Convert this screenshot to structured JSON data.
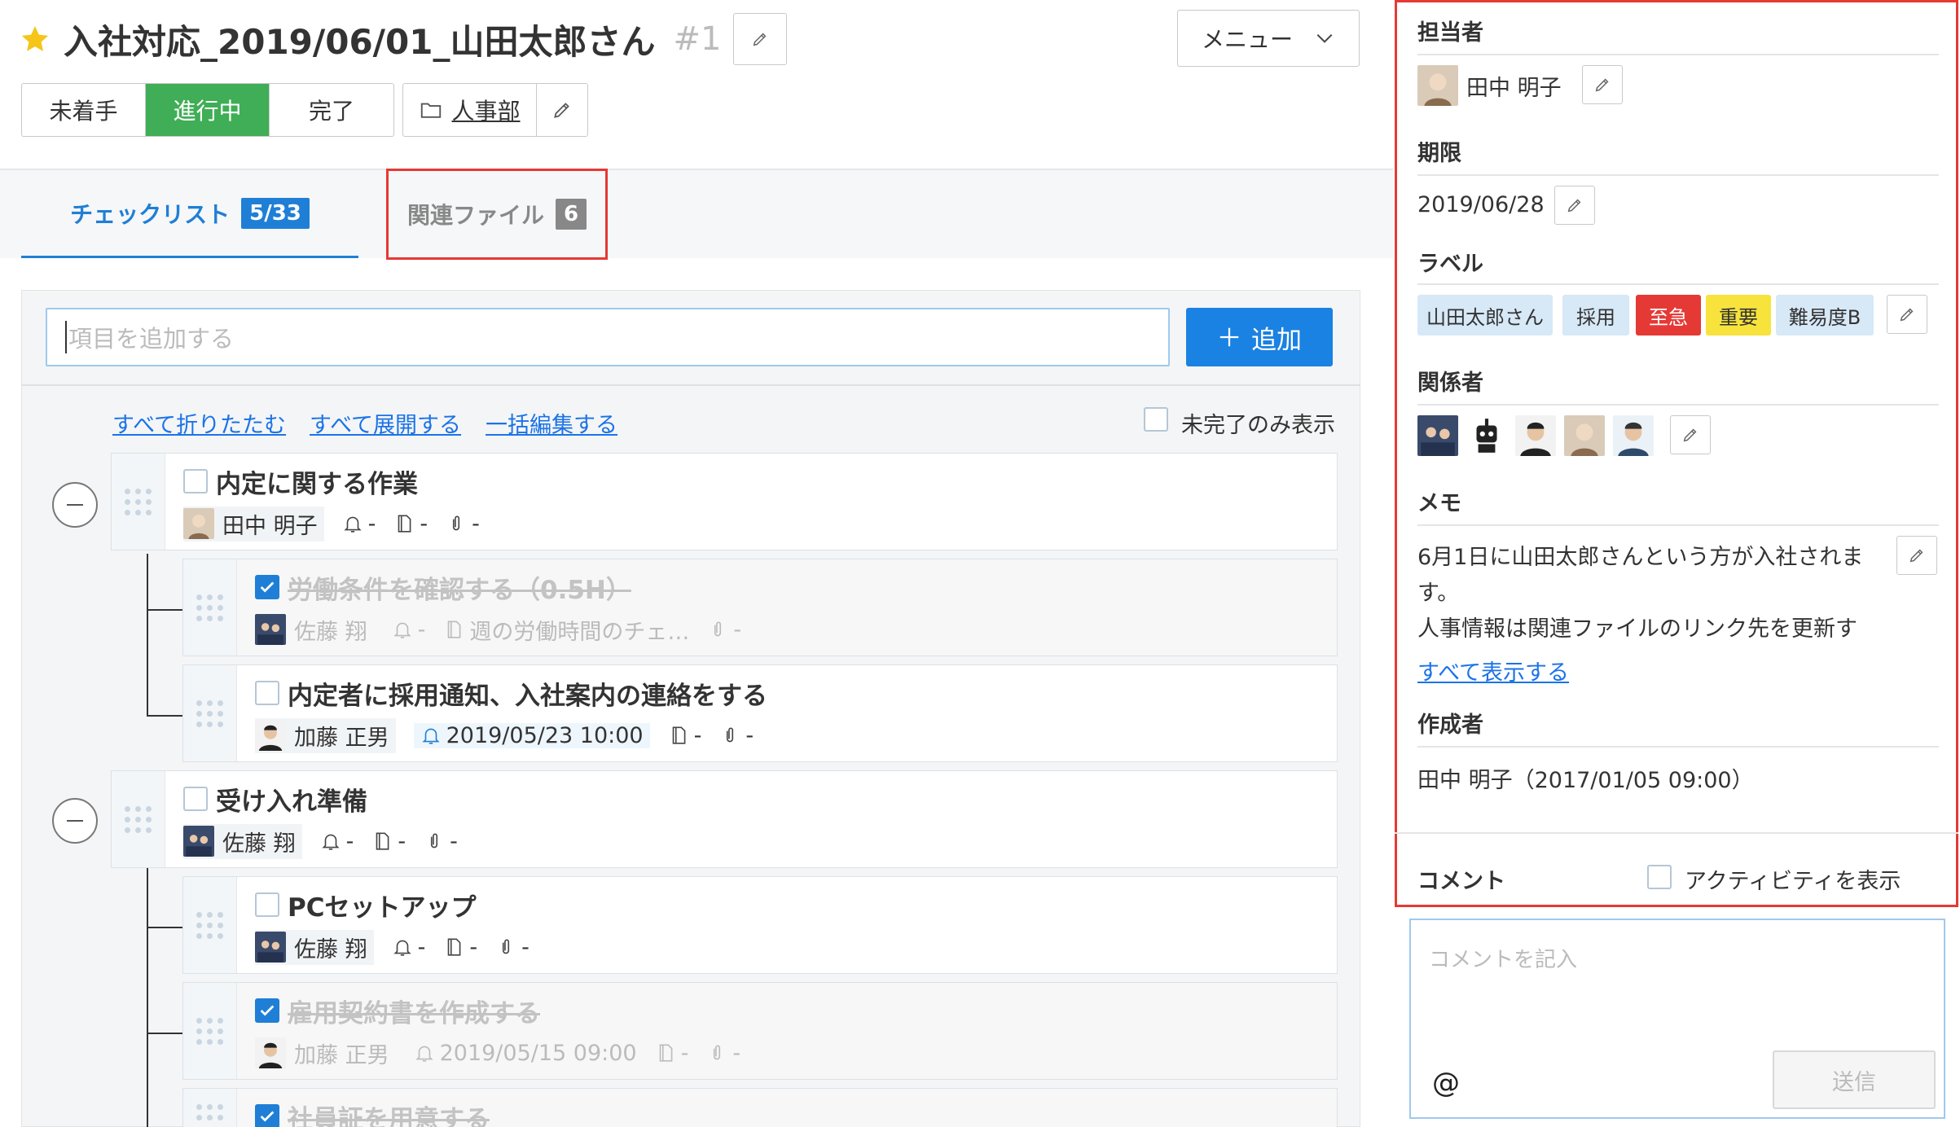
{
  "header": {
    "title": "入社対応_2019/06/01_山田太郎さん",
    "number": "#1",
    "menu_label": "メニュー"
  },
  "status": {
    "options": [
      "未着手",
      "進行中",
      "完了"
    ],
    "active": "進行中"
  },
  "department": {
    "label": "人事部"
  },
  "tabs": {
    "checklist": {
      "label": "チェックリスト",
      "badge": "5/33"
    },
    "files": {
      "label": "関連ファイル",
      "badge": "6"
    }
  },
  "checklist": {
    "add_placeholder": "項目を追加する",
    "add_button": "追加",
    "links": {
      "collapse_all": "すべて折りたたむ",
      "expand_all": "すべて展開する",
      "bulk_edit": "一括編集する"
    },
    "incomplete_only_label": "未完了のみ表示",
    "items": [
      {
        "title": "内定に関する作業",
        "assignee": "田中 明子",
        "reminder": "-",
        "note": "-",
        "attach": "-",
        "checked": false
      },
      {
        "title": "労働条件を確認する（0.5H）",
        "assignee": "佐藤 翔",
        "reminder": "-",
        "note": "週の労働時間のチェ…",
        "attach": "-",
        "checked": true
      },
      {
        "title": "内定者に採用通知、入社案内の連絡をする",
        "assignee": "加藤 正男",
        "reminder": "2019/05/23 10:00",
        "note": "-",
        "attach": "-",
        "checked": false
      },
      {
        "title": "受け入れ準備",
        "assignee": "佐藤 翔",
        "reminder": "-",
        "note": "-",
        "attach": "-",
        "checked": false
      },
      {
        "title": "PCセットアップ",
        "assignee": "佐藤 翔",
        "reminder": "-",
        "note": "-",
        "attach": "-",
        "checked": false
      },
      {
        "title": "雇用契約書を作成する",
        "assignee": "加藤 正男",
        "reminder": "2019/05/15 09:00",
        "note": "-",
        "attach": "-",
        "checked": true
      },
      {
        "title": "社員証を用意する",
        "checked": true
      }
    ]
  },
  "sidebar": {
    "assignee_heading": "担当者",
    "assignee_name": "田中 明子",
    "due_heading": "期限",
    "due_date": "2019/06/28",
    "label_heading": "ラベル",
    "labels": [
      {
        "text": "山田太郎さん",
        "bg": "#d7e8f7",
        "fg": "#333333"
      },
      {
        "text": "採用",
        "bg": "#d7e8f7",
        "fg": "#333333"
      },
      {
        "text": "至急",
        "bg": "#e53935",
        "fg": "#ffffff"
      },
      {
        "text": "重要",
        "bg": "#f7e33b",
        "fg": "#333333"
      },
      {
        "text": "難易度B",
        "bg": "#d7e8f7",
        "fg": "#333333"
      }
    ],
    "members_heading": "関係者",
    "memo_heading": "メモ",
    "memo_line1": "6月1日に山田太郎さんという方が入社されま",
    "memo_line2": "す。",
    "memo_line3": "人事情報は関連ファイルのリンク先を更新す",
    "memo_show_all": "すべて表示する",
    "creator_heading": "作成者",
    "creator_text": "田中 明子（2017/01/05 09:00）",
    "comment_heading": "コメント",
    "activity_label": "アクティビティを表示",
    "comment_placeholder": "コメントを記入",
    "at_symbol": "@",
    "send_label": "送信"
  },
  "colors": {
    "accent": "#1f7fd6",
    "active_status": "#3fae56",
    "highlight_box": "#e53935"
  }
}
